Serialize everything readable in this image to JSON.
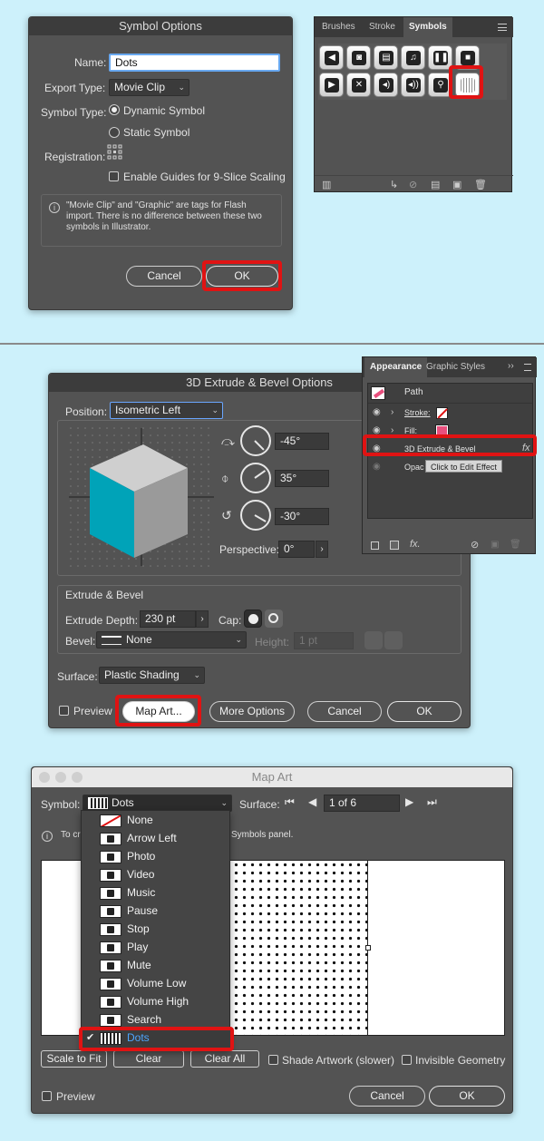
{
  "symbol_options": {
    "title": "Symbol Options",
    "name_label": "Name:",
    "name_value": "Dots",
    "export_type_label": "Export Type:",
    "export_type_value": "Movie Clip",
    "symbol_type_label": "Symbol Type:",
    "dynamic_label": "Dynamic Symbol",
    "static_label": "Static Symbol",
    "registration_label": "Registration:",
    "guides_label": "Enable Guides for 9-Slice Scaling",
    "info_text": "\"Movie Clip\" and \"Graphic\" are tags for Flash import. There is no difference between these two symbols in Illustrator.",
    "cancel_label": "Cancel",
    "ok_label": "OK"
  },
  "symbols_panel": {
    "tabs": [
      "Brushes",
      "Stroke",
      "Symbols"
    ],
    "menu_icon": "hamburger-icon",
    "symbols": [
      "arrow-left-icon",
      "photo-icon",
      "video-icon",
      "music-icon",
      "pause-icon",
      "stop-icon",
      "play-icon",
      "mute-icon",
      "volume-low-icon",
      "volume-high-icon",
      "search-icon",
      "dots-icon"
    ]
  },
  "extrude_dialog": {
    "title": "3D Extrude & Bevel Options",
    "position_label": "Position:",
    "position_value": "Isometric Left",
    "angle_x": "-45°",
    "angle_y": "35°",
    "angle_z": "-30°",
    "perspective_label": "Perspective:",
    "perspective_value": "0°",
    "extrude_section": "Extrude & Bevel",
    "extrude_depth_label": "Extrude Depth:",
    "extrude_depth_value": "230 pt",
    "cap_label": "Cap:",
    "bevel_label": "Bevel:",
    "bevel_value": "None",
    "height_label": "Height:",
    "height_value": "1 pt",
    "surface_label": "Surface:",
    "surface_value": "Plastic Shading",
    "preview_label": "Preview",
    "map_art_label": "Map Art...",
    "more_options_label": "More Options",
    "cancel_label": "Cancel",
    "ok_label": "OK",
    "colors": {
      "cube_top": "#cfcfcf",
      "cube_left": "#00a3b8",
      "cube_right": "#9a9a9a"
    }
  },
  "appearance_panel": {
    "tabs": [
      "Appearance",
      "Graphic Styles"
    ],
    "path_label": "Path",
    "stroke_label": "Stroke:",
    "fill_label": "Fill:",
    "effect_label": "3D Extrude & Bevel",
    "fx_label": "fx",
    "opacity_label": "Opac",
    "tooltip": "Click to Edit Effect",
    "fill_color": "#e9507e"
  },
  "map_art": {
    "title": "Map Art",
    "symbol_label": "Symbol:",
    "symbol_value": "Dots",
    "surface_label": "Surface:",
    "surface_value": "1 of 6",
    "info_prefix": "To cr",
    "info_suffix": "Symbols panel.",
    "menu": [
      "None",
      "Arrow Left",
      "Photo",
      "Video",
      "Music",
      "Pause",
      "Stop",
      "Play",
      "Mute",
      "Volume Low",
      "Volume High",
      "Search",
      "Dots"
    ],
    "selected": "Dots",
    "scale_to_fit_label": "Scale to Fit",
    "clear_label": "Clear",
    "clear_all_label": "Clear All",
    "shade_label": "Shade Artwork (slower)",
    "invisible_label": "Invisible Geometry",
    "preview_label": "Preview",
    "cancel_label": "Cancel",
    "ok_label": "OK"
  },
  "highlight_color": "#e01313"
}
